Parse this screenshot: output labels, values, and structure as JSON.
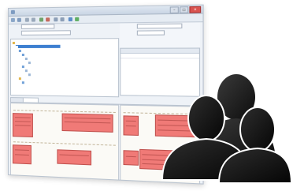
{
  "window": {
    "title": "",
    "controls": [
      "–",
      "□",
      "✕"
    ]
  },
  "toolbar": {
    "button_icons": [
      "open-icon",
      "save-icon",
      "back-icon",
      "forward-icon",
      "run-icon",
      "stop-icon",
      "zoom-in-icon",
      "zoom-out-icon",
      "refresh-icon",
      "help-icon"
    ]
  },
  "filter": {
    "label_1": "",
    "label_2": "",
    "value": ""
  },
  "tree": {
    "nodes": [
      "",
      "",
      "",
      "",
      "",
      "",
      "",
      "",
      "",
      "",
      ""
    ]
  },
  "properties": {
    "columns": [
      "",
      "",
      ""
    ],
    "rows": [
      [
        "",
        "",
        ""
      ]
    ]
  },
  "tabs": [
    "",
    ""
  ],
  "canvas": {
    "left_title": "",
    "right_title": ""
  },
  "colors": {
    "window_bg": "#eef2f7",
    "selection": "#3d7fd0",
    "box_fill": "#f07a77",
    "box_border": "#c0504d",
    "silhouette": "#1e1e1e"
  }
}
